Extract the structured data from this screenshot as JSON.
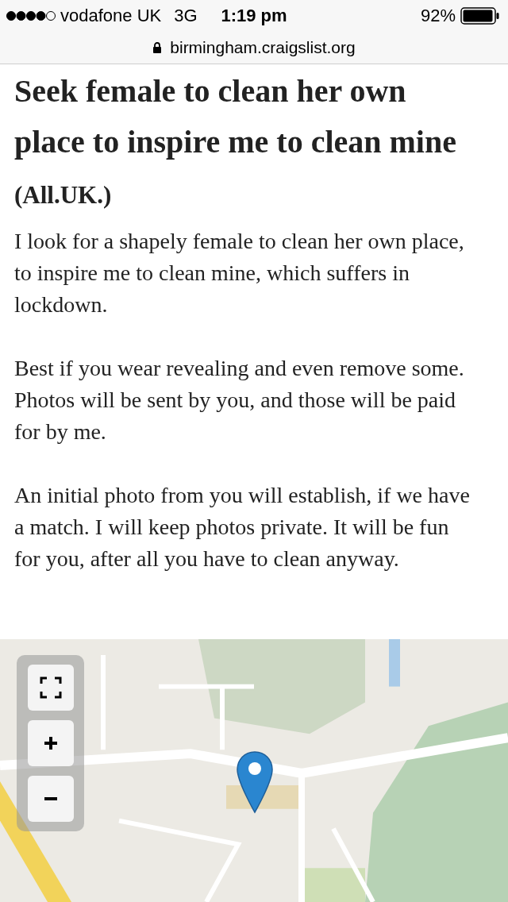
{
  "status_bar": {
    "carrier": "vodafone UK",
    "network": "3G",
    "time": "1:19 pm",
    "battery": "92%"
  },
  "address_bar": {
    "url": "birmingham.craigslist.org"
  },
  "posting": {
    "title": "Seek female to clean her own place to inspire me to clean mine",
    "location": "(All.UK.)",
    "paragraphs": [
      "I look for a shapely female to clean her own place, to inspire me to clean mine, which suffers in lockdown.",
      "Best if you wear revealing and even remove some. Photos will be sent by you, and those will be paid for by me.",
      "An initial photo from you will establish, if we have a match. I will keep photos private. It will be fun for you, after all you have to clean anyway."
    ]
  }
}
